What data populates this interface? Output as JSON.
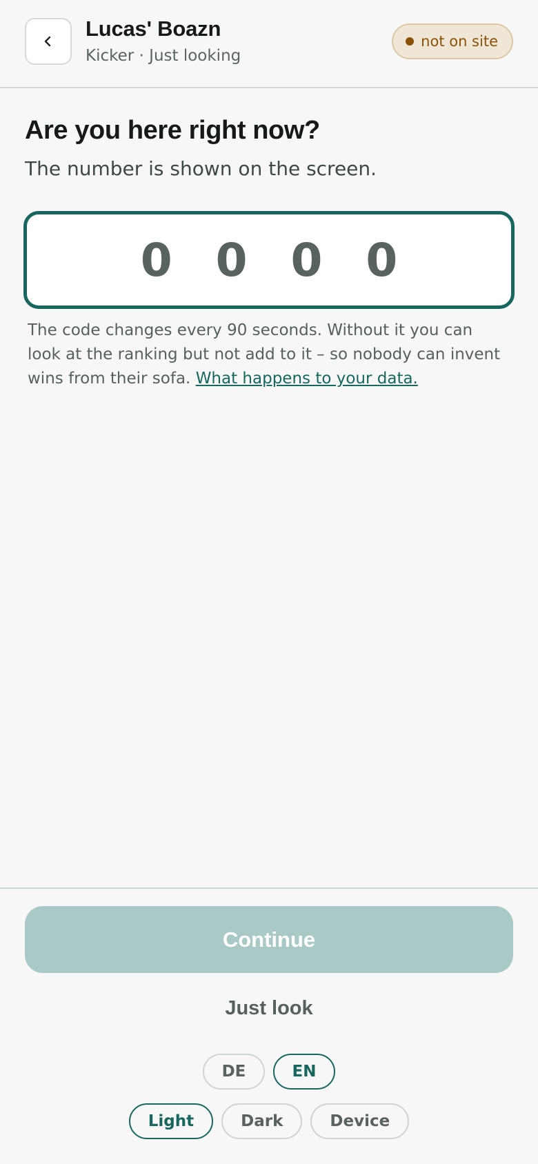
{
  "header": {
    "back_icon": "chevron-left-icon",
    "title": "Lucas' Boazn",
    "subtitle": "Kicker · Just looking",
    "status": {
      "label": "not on site",
      "color": "#8a5208",
      "background": "#f0e6d6"
    }
  },
  "main": {
    "question": "Are you here right now?",
    "question_sub": "The number is shown on the screen.",
    "code_input": {
      "value": "0000",
      "display": "0 0 0 0",
      "border_color": "#17675e"
    },
    "hint_text": "The code changes every 90 seconds. Without it you can look at the ranking but not add to it – so nobody can invent wins from their sofa.",
    "hint_link": "What happens to your data."
  },
  "footer": {
    "continue_label": "Continue",
    "just_look_label": "Just look",
    "languages": [
      {
        "label": "DE",
        "active": false
      },
      {
        "label": "EN",
        "active": true
      }
    ],
    "themes": [
      {
        "label": "Light",
        "active": true
      },
      {
        "label": "Dark",
        "active": false
      },
      {
        "label": "Device",
        "active": false
      }
    ]
  },
  "colors": {
    "accent": "#17675e",
    "continue_disabled": "#a9c9c6",
    "background": "#f7f7f7"
  }
}
